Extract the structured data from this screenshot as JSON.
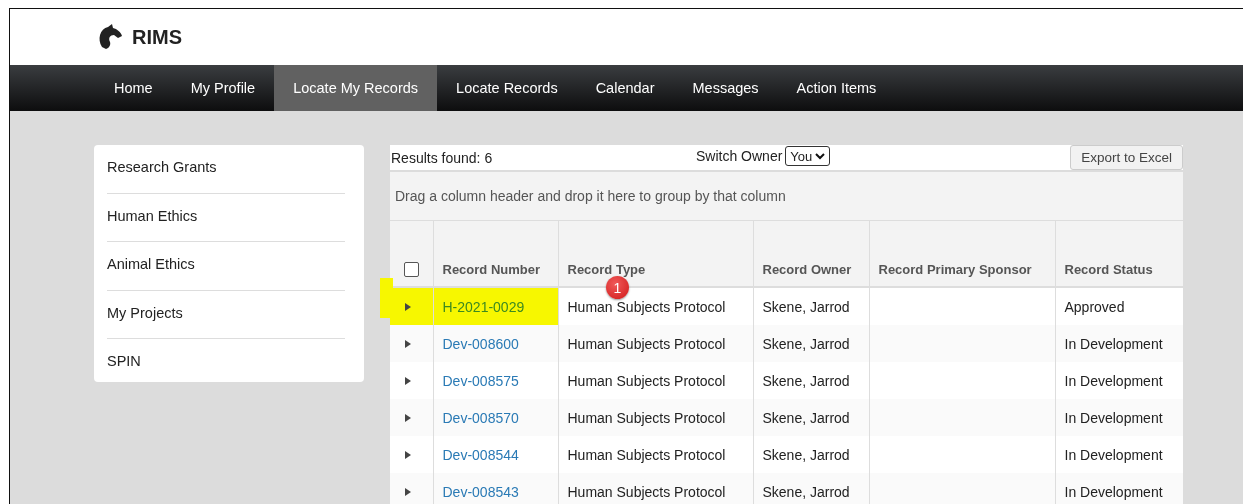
{
  "app": {
    "name": "RIMS"
  },
  "nav": [
    {
      "label": "Home",
      "selected": false
    },
    {
      "label": "My Profile",
      "selected": false
    },
    {
      "label": "Locate My Records",
      "selected": true
    },
    {
      "label": "Locate Records",
      "selected": false
    },
    {
      "label": "Calendar",
      "selected": false
    },
    {
      "label": "Messages",
      "selected": false
    },
    {
      "label": "Action Items",
      "selected": false
    }
  ],
  "sidebar": {
    "items": [
      "Research Grants",
      "Human Ethics",
      "Animal Ethics",
      "My Projects",
      "SPIN"
    ]
  },
  "toolbar": {
    "results": "Results found: 6",
    "switch_owner_label": "Switch Owner",
    "switch_owner_value": "You",
    "export_button": "Export to Excel"
  },
  "group_hint": "Drag a column header and drop it here to group by that column",
  "table": {
    "select_all_checked": false,
    "columns": [
      "Record Number",
      "Record Type",
      "Record Owner",
      "Record Primary Sponsor",
      "Record Status"
    ],
    "rows": [
      {
        "number": "H-2021-0029",
        "type": "Human Subjects Protocol",
        "owner": "Skene, Jarrod",
        "status": "Approved",
        "highlighted": true
      },
      {
        "number": "Dev-008600",
        "type": "Human Subjects Protocol",
        "owner": "Skene, Jarrod",
        "status": "In Development",
        "highlighted": false
      },
      {
        "number": "Dev-008575",
        "type": "Human Subjects Protocol",
        "owner": "Skene, Jarrod",
        "status": "In Development",
        "highlighted": false
      },
      {
        "number": "Dev-008570",
        "type": "Human Subjects Protocol",
        "owner": "Skene, Jarrod",
        "status": "In Development",
        "highlighted": false
      },
      {
        "number": "Dev-008544",
        "type": "Human Subjects Protocol",
        "owner": "Skene, Jarrod",
        "status": "In Development",
        "highlighted": false
      },
      {
        "number": "Dev-008543",
        "type": "Human Subjects Protocol",
        "owner": "Skene, Jarrod",
        "status": "In Development",
        "highlighted": false
      }
    ]
  },
  "callout": {
    "label": "1"
  }
}
